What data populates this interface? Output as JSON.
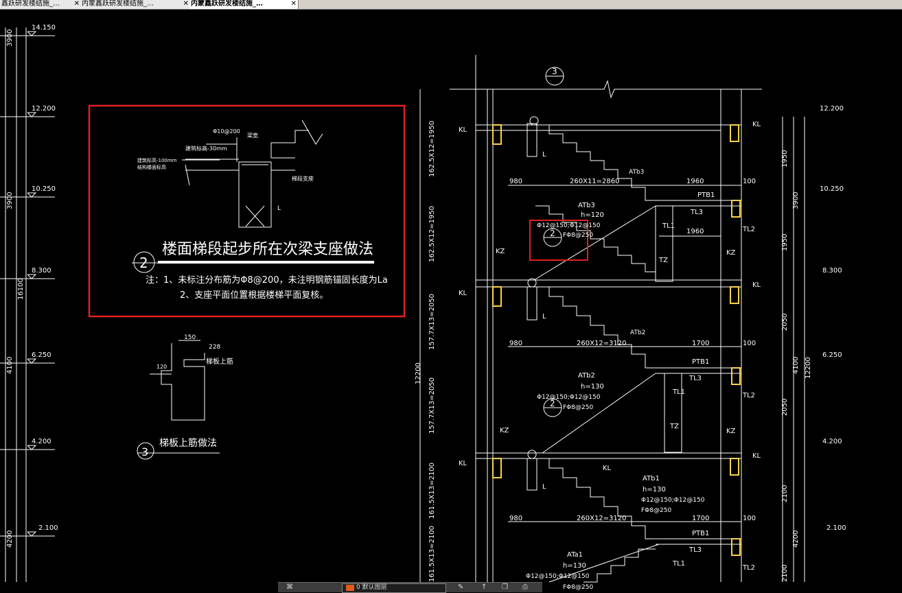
{
  "tabs": [
    {
      "label": "鑫跃研发楼结施_…",
      "active": false
    },
    {
      "label": "内蒙鑫跃研发楼结施_…",
      "active": false
    },
    {
      "label": "内蒙鑫跃研发楼结施_…",
      "active": true
    }
  ],
  "colors": {
    "background": "#000000",
    "line": "#ffffff",
    "highlight": "#e02020",
    "hatch": "#ffd24a"
  },
  "left_levels": {
    "elevations": [
      "14.150",
      "12.200",
      "10.250",
      "8.300",
      "6.250",
      "4.200",
      "2.100"
    ],
    "dims": [
      "3900",
      "3900",
      "16100",
      "4100",
      "4200"
    ]
  },
  "detail2": {
    "title": "楼面梯段起步所在次梁支座做法",
    "number": "2",
    "note1": "注：1、未标注分布筋为Φ8@200，未注明钢筋锚固长度为La",
    "note2": "2、支座平面位置根据楼梯平面复核。",
    "labels": [
      "Φ10@200",
      "梁宽",
      "建筑标高-30mm",
      "建筑标高-100mm",
      "结构楼面标高",
      "梯段支座",
      "L"
    ]
  },
  "detail3": {
    "title": "梯板上筋做法",
    "number": "3",
    "labels": [
      "150",
      "228",
      "梯板上筋",
      "120"
    ]
  },
  "section": {
    "callouts": {
      "top": "3",
      "mid1": "2",
      "mid2": "2"
    },
    "beams": [
      "KL",
      "KL",
      "KL",
      "KL",
      "KL",
      "KL",
      "KL"
    ],
    "dims_left": [
      "162.5X12=1950",
      "162.5X12=1950",
      "157.7X13=2050",
      "157.7X13=2050",
      "161.5X13=2100",
      "161.5X13=2100",
      "12200"
    ],
    "dims_right": [
      "1950",
      "1950",
      "2050",
      "2050",
      "2100",
      "2100",
      "12200"
    ],
    "right_levels": [
      "12.200",
      "10.250",
      "8.300",
      "6.250",
      "4.200",
      "2.100"
    ],
    "right_dim_groups": [
      "3900",
      "4100",
      "4200"
    ],
    "span_rows": [
      {
        "a": "980",
        "b": "260X11=2860",
        "c": "1960",
        "d": "100"
      },
      {
        "a": "980",
        "b": "260X12=3120",
        "c": "1700",
        "d": "100"
      },
      {
        "a": "980",
        "b": "260X12=3120",
        "c": "1700",
        "d": "100"
      }
    ],
    "flights": [
      {
        "name": "ATb3",
        "h": "h=120",
        "rebar": "Φ12@150;Φ12@150",
        "dist": "FΦ8@250"
      },
      {
        "name": "ATb2",
        "h": "h=130",
        "rebar": "Φ12@150;Φ12@150",
        "dist": "FΦ8@250"
      },
      {
        "name": "ATb1",
        "h": "h=130",
        "rebar": "Φ12@150;Φ12@150",
        "dist": "FΦ8@250"
      },
      {
        "name": "ATa1",
        "h": "h=130",
        "rebar": "Φ12@150;Φ12@150",
        "dist": "FΦ8@250"
      }
    ],
    "labels": {
      "ptb": "PTB1",
      "tl1": "TL1",
      "tl2": "TL2",
      "tl3": "TL3",
      "tz": "TZ",
      "kz": "KZ",
      "l": "L",
      "inner_1960": "1960",
      "kl_mid": "KL",
      "atb3_top": "ATb3",
      "atb2_top": "ATb2"
    }
  },
  "statusbar": {
    "field": "0 默认图层"
  }
}
